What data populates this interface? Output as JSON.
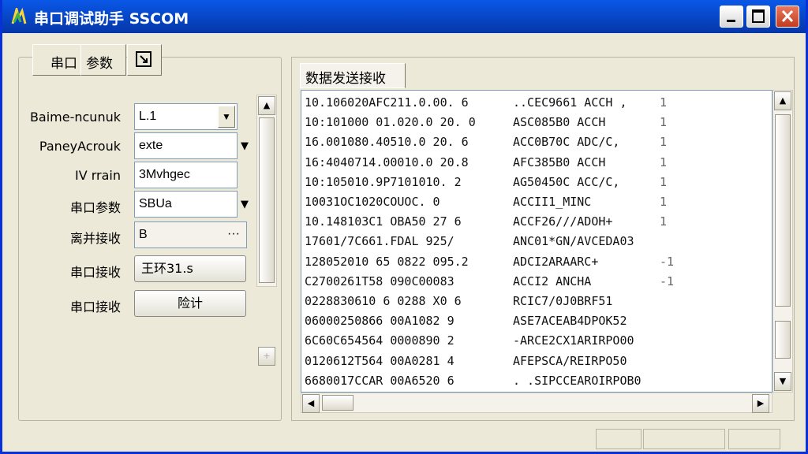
{
  "window": {
    "title": "串口调试助手 SSCOM"
  },
  "left_tabs": [
    "串口",
    "参数"
  ],
  "form": {
    "rows": [
      {
        "label": "Baime-ncunuk",
        "value": "L.1"
      },
      {
        "label": "PaneyAcrouk",
        "value": "exte"
      },
      {
        "label": "IV rrain",
        "value": "3Mvhgec"
      },
      {
        "label": "串口参数",
        "value": "SBUa"
      },
      {
        "label": "离并接收",
        "value": "B"
      },
      {
        "label": "串口接收",
        "value": "王环31.s"
      },
      {
        "label": "串口接收",
        "value": "险计"
      }
    ],
    "dots": "···"
  },
  "receive": {
    "tab_label": "数据发送接收",
    "rows": [
      {
        "hex": "10.106020AFC211.0.00. 6",
        "ascii": "..CEC9661 ACCH ,",
        "n": "1"
      },
      {
        "hex": "10:101000 01.020.0 20. 0",
        "ascii": "ASC085B0 ACCH",
        "n": "1"
      },
      {
        "hex": "16.001080.40510.0 20. 6",
        "ascii": "ACC0B70C ADC/C,",
        "n": "1"
      },
      {
        "hex": "16:4040714.00010.0 20.8",
        "ascii": "AFC385B0 ACCH",
        "n": "1"
      },
      {
        "hex": "10:105010.9P7101010. 2",
        "ascii": "AG50450C ACC/C,",
        "n": "1"
      },
      {
        "hex": "10031OC1020COUOC. 0",
        "ascii": "ACCII1_MINC",
        "n": "1"
      },
      {
        "hex": "10.148103C1 OBA50 27 6",
        "ascii": "ACCF26///ADOH+",
        "n": "1"
      },
      {
        "hex": "17601/7C661.FDAL 925/",
        "ascii": "ANC01*GN/AVCEDA03",
        "n": ""
      },
      {
        "hex": "128052010 65 0822 095.2",
        "ascii": "ADCI2ARAARC+",
        "n": "-1"
      },
      {
        "hex": "C2700261T58 090C00083",
        "ascii": "ACCI2 ANCHA",
        "n": "-1"
      },
      {
        "hex": "0228830610 6 0288 X0 6",
        "ascii": "RCIC7/0J0BRF51",
        "n": ""
      },
      {
        "hex": "06000250866 00A1082 9",
        "ascii": "ASE7ACEAB4DPOK52",
        "n": ""
      },
      {
        "hex": "6C60C654564 0000890 2",
        "ascii": "-ARCE2CX1ARIRPO00",
        "n": ""
      },
      {
        "hex": "0120612T564 00A0281 4",
        "ascii": "AFEPSCA/REIRPO50",
        "n": ""
      },
      {
        "hex": "6680017CCAR 00A6520 6",
        "ascii": ". .SIPCCEAROIRPOB0",
        "n": ""
      }
    ]
  },
  "colors": {
    "titlebar": "#0747C8",
    "face": "#ECE9D8"
  },
  "icons": [
    "app-icon",
    "resize-icon",
    "minimize-icon",
    "maximize-icon",
    "close-icon",
    "dropdown-arrow-icon",
    "scroll-up-icon",
    "scroll-down-icon",
    "scroll-left-icon",
    "scroll-right-icon",
    "plus-icon"
  ]
}
